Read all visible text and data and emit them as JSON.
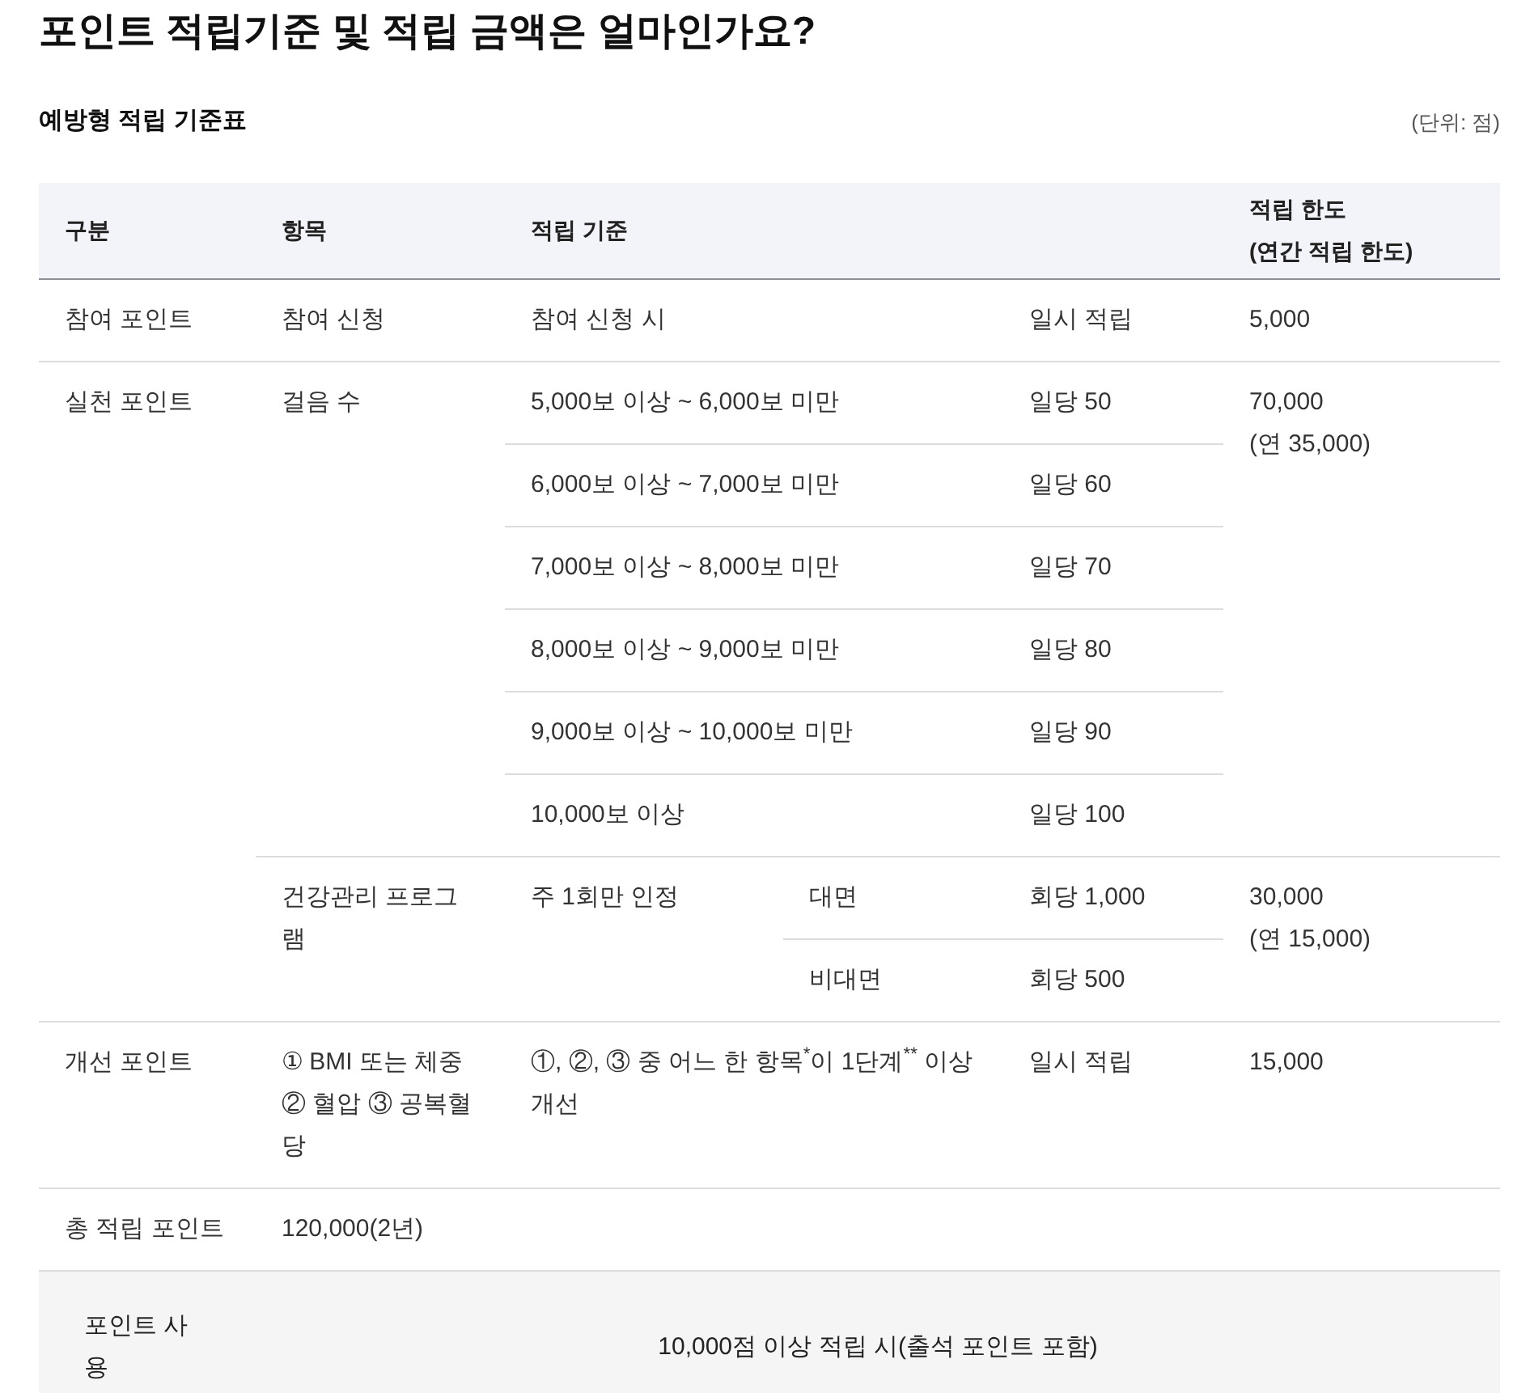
{
  "title": "포인트 적립기준 및 적립 금액은 얼마인가요?",
  "table_caption": "예방형 적립 기준표",
  "unit": "(단위: 점)",
  "columns": [
    "구분",
    "항목",
    "적립 기준",
    "적립 한도\n(연간 적립 한도)"
  ],
  "rows": [
    {
      "kind": "simple",
      "category": "참여 포인트",
      "item": "참여 신청",
      "criterion": "참여 신청 시",
      "method": "일시 적립",
      "limit": "5,000"
    },
    {
      "kind": "grouped",
      "category": "실천 포인트",
      "groups": [
        {
          "kind": "steps",
          "item": "걸음 수",
          "criteria": [
            {
              "condition": "5,000보 이상 ~ 6,000보 미만",
              "rate": "일당 50"
            },
            {
              "condition": "6,000보 이상 ~ 7,000보 미만",
              "rate": "일당 60"
            },
            {
              "condition": "7,000보 이상 ~ 8,000보 미만",
              "rate": "일당 70"
            },
            {
              "condition": "8,000보 이상 ~ 9,000보 미만",
              "rate": "일당 80"
            },
            {
              "condition": "9,000보 이상 ~ 10,000보 미만",
              "rate": "일당 90"
            },
            {
              "condition": "10,000보 이상",
              "rate": "일당 100"
            }
          ],
          "limit": "70,000\n(연 35,000)"
        },
        {
          "kind": "program",
          "item": "건강관리 프로그램",
          "note": "주 1회만 인정",
          "criteria": [
            {
              "condition": "대면",
              "rate": "회당 1,000"
            },
            {
              "condition": "비대면",
              "rate": "회당 500"
            }
          ],
          "limit": "30,000\n(연 15,000)"
        }
      ]
    },
    {
      "kind": "simple",
      "category": "개선 포인트",
      "item": "① BMI 또는 체중 ② 혈압 ③ 공복혈당",
      "criterion": "①, ②, ③ 중 어느 한 항목$^{*}$이 1단계$^{**}$ 이상 개선",
      "method": "일시 적립",
      "limit": "15,000"
    },
    {
      "kind": "total",
      "category": "총 적립 포인트",
      "value": "120,000(2년)"
    },
    {
      "kind": "usage",
      "category": "포인트 사용",
      "value": "10,000점 이상 적립 시(출석 포인트 포함)"
    }
  ]
}
